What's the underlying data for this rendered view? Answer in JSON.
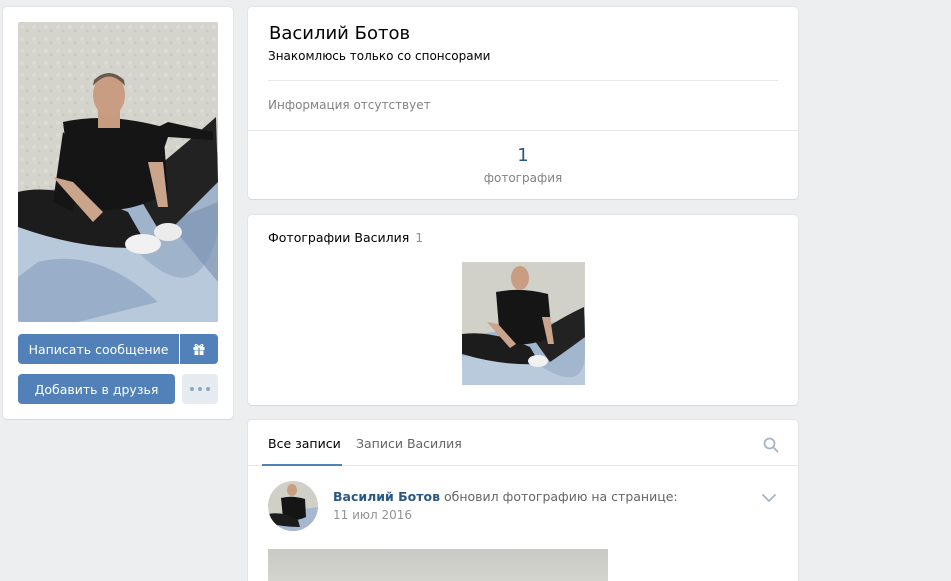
{
  "profile": {
    "name": "Василий Ботов",
    "status": "Знакомлюсь только со спонсорами",
    "no_info": "Информация отсутствует",
    "photo_count": "1",
    "photo_count_label": "фотография"
  },
  "actions": {
    "message_label": "Написать сообщение",
    "add_friend_label": "Добавить в друзья",
    "gift_icon": "gift-icon",
    "more_icon": "more-dots-icon"
  },
  "photos": {
    "title": "Фотографии Василия",
    "count": "1"
  },
  "wall": {
    "tabs": [
      {
        "label": "Все записи",
        "active": true
      },
      {
        "label": "Записи Василия",
        "active": false
      }
    ],
    "search_icon": "search-icon",
    "post": {
      "author": "Василий Ботов",
      "action": "обновил фотографию на странице:",
      "date": "11 июл 2016"
    }
  },
  "colors": {
    "accent": "#5181b8",
    "link": "#2a5885",
    "background": "#edeef0",
    "muted": "#828282"
  }
}
